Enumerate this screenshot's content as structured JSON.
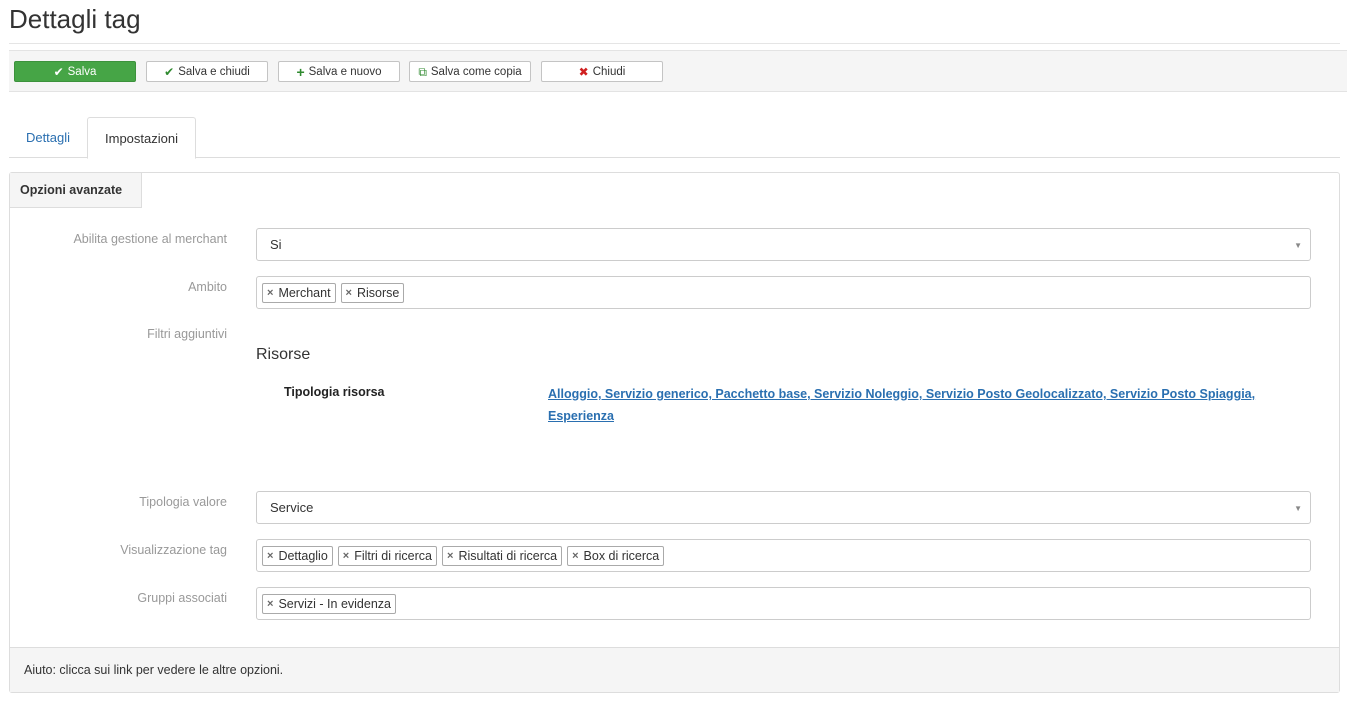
{
  "page": {
    "title": "Dettagli tag"
  },
  "toolbar": {
    "save": "Salva",
    "save_close": "Salva e chiudi",
    "save_new": "Salva e nuovo",
    "save_copy": "Salva come copia",
    "close": "Chiudi"
  },
  "tabs": [
    {
      "label": "Dettagli",
      "active": false
    },
    {
      "label": "Impostazioni",
      "active": true
    }
  ],
  "panel": {
    "title": "Opzioni avanzate",
    "merchant": {
      "label": "Abilita gestione al merchant",
      "value": "Si"
    },
    "ambito": {
      "label": "Ambito",
      "tags": [
        "Merchant",
        "Risorse"
      ]
    },
    "filtri": {
      "label": "Filtri aggiuntivi",
      "section": "Risorse",
      "name": "Tipologia risorsa",
      "value": "Alloggio, Servizio generico, Pacchetto base, Servizio Noleggio, Servizio Posto Geolocalizzato, Servizio Posto Spiaggia, Esperienza"
    },
    "tipologia": {
      "label": "Tipologia valore",
      "value": "Service"
    },
    "visualizzazione": {
      "label": "Visualizzazione tag",
      "tags": [
        "Dettaglio",
        "Filtri di ricerca",
        "Risultati di ricerca",
        "Box di ricerca"
      ]
    },
    "gruppi": {
      "label": "Gruppi associati",
      "tags": [
        "Servizi - In evidenza"
      ]
    },
    "help": "Aiuto: clicca sui link per vedere le altre opzioni."
  },
  "colors": {
    "primary": "#46a546",
    "link": "#2a6fb0",
    "danger": "#d02020"
  }
}
